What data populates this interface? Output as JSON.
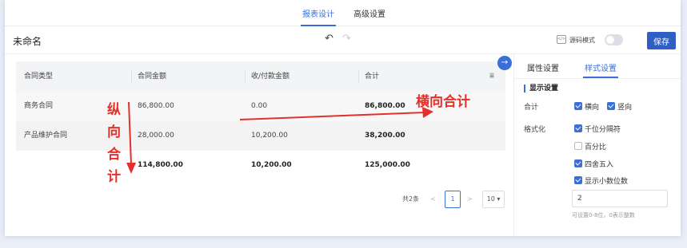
{
  "topnav": {
    "tabs": [
      {
        "label": "报表设计",
        "active": true
      },
      {
        "label": "高级设置",
        "active": false
      }
    ]
  },
  "toolbar": {
    "title": "未命名",
    "undo_icon": "undo-icon",
    "redo_icon": "redo-icon",
    "source_icon_text": "</>",
    "source_mode_label": "源码模式",
    "source_mode_on": false,
    "save_label": "保存"
  },
  "table": {
    "headers": [
      "合同类型",
      "合同金额",
      "收/付款金额",
      "合计"
    ],
    "rows": [
      [
        "商务合同",
        "86,800.00",
        "0.00",
        "86,800.00"
      ],
      [
        "产品维护合同",
        "28,000.00",
        "10,200.00",
        "38,200.00"
      ],
      [
        "",
        "114,800.00",
        "10,200.00",
        "125,000.00"
      ]
    ]
  },
  "pagination": {
    "total": "共2条",
    "prev": "<",
    "page": "1",
    "next": ">",
    "page_size": "10 ▾"
  },
  "panel": {
    "tabs": [
      {
        "label": "属性设置",
        "active": false
      },
      {
        "label": "样式设置",
        "active": true
      }
    ],
    "section_title": "显示设置",
    "total_label": "合计",
    "horizontal_label": "横向",
    "vertical_label": "竖向",
    "format_label": "格式化",
    "thousands_label": "千位分隔符",
    "percent_label": "百分比",
    "round_label": "四舍五入",
    "decimals_label": "显示小数位数",
    "decimals_value": "2",
    "decimals_hint": "可设置0-8位，0表示整数"
  },
  "annotations": {
    "horizontal": "横向合计",
    "vertical": [
      "纵",
      "向",
      "合",
      "计"
    ],
    "color": "#e4302a"
  },
  "colors": {
    "accent": "#3a6fd8",
    "save_button": "#2f5fc4"
  }
}
